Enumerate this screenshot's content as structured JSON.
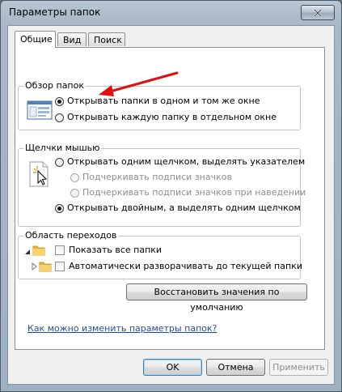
{
  "window": {
    "title": "Параметры папок"
  },
  "tabs": [
    {
      "label": "Общие",
      "active": true
    },
    {
      "label": "Вид",
      "active": false
    },
    {
      "label": "Поиск",
      "active": false
    }
  ],
  "browse_group": {
    "title": "Обзор папок",
    "options": [
      {
        "label": "Открывать папки в одном и том же окне",
        "checked": true
      },
      {
        "label": "Открывать каждую папку в отдельном окне",
        "checked": false
      }
    ]
  },
  "click_group": {
    "title": "Щелчки мышью",
    "option_single": {
      "label": "Открывать одним щелчком, выделять указателем",
      "checked": false
    },
    "sub_options": [
      {
        "label": "Подчеркивать подписи значков",
        "checked": false,
        "disabled": true
      },
      {
        "label": "Подчеркивать подписи значков при наведении",
        "checked": false,
        "disabled": true
      }
    ],
    "option_double": {
      "label": "Открывать двойным, а выделять одним щелчком",
      "checked": true
    }
  },
  "nav_group": {
    "title": "Область переходов",
    "options": [
      {
        "label": "Показать все папки",
        "checked": false
      },
      {
        "label": "Автоматически разворачивать до текущей папки",
        "checked": false
      }
    ]
  },
  "restore_button": "Восстановить значения по умолчанию",
  "help_link": "Как можно изменить параметры папок?",
  "buttons": {
    "ok": "OK",
    "cancel": "Отмена",
    "apply": "Применить"
  },
  "colors": {
    "annotation_arrow": "#e01010",
    "link": "#1f4e99",
    "folder": "#f2c94c"
  }
}
